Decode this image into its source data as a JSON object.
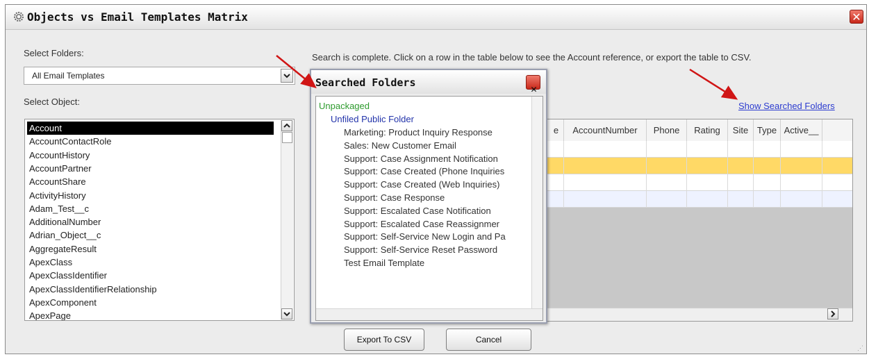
{
  "window": {
    "title": "Objects vs Email Templates Matrix"
  },
  "labels": {
    "select_folders": "Select Folders:",
    "select_object": "Select Object:"
  },
  "folder_select": {
    "value": "All Email Templates"
  },
  "objects": {
    "selected": "Account",
    "items": [
      "Account",
      "AccountContactRole",
      "AccountHistory",
      "AccountPartner",
      "AccountShare",
      "ActivityHistory",
      "Adam_Test__c",
      "AdditionalNumber",
      "Adrian_Object__c",
      "AggregateResult",
      "ApexClass",
      "ApexClassIdentifier",
      "ApexClassIdentifierRelationship",
      "ApexComponent",
      "ApexPage"
    ]
  },
  "status_message": "Search is complete. Click on a row in the table below to see the Account reference, or export the table to CSV.",
  "show_folders_link": "Show Searched Folders",
  "table": {
    "columns": [
      "e",
      "AccountNumber",
      "Phone",
      "Rating",
      "Site",
      "Type",
      "Active__"
    ],
    "highlight_row": 1
  },
  "buttons": {
    "export": "Export To CSV",
    "cancel": "Cancel"
  },
  "popup": {
    "title": "Searched Folders",
    "root": "Unpackaged",
    "folder": "Unfiled Public Folder",
    "templates": [
      "Marketing: Product Inquiry Response",
      "Sales: New Customer Email",
      "Support: Case Assignment Notification",
      "Support: Case Created (Phone Inquiries",
      "Support: Case Created (Web Inquiries)",
      "Support: Case Response",
      "Support: Escalated Case Notification",
      "Support: Escalated Case Reassignmer",
      "Support: Self-Service New Login and Pa",
      "Support: Self-Service Reset Password",
      "Test Email Template"
    ]
  },
  "colors": {
    "highlight_row": "#ffd966",
    "link": "#2b3bcf",
    "tree_root": "#2e9b2e",
    "tree_folder": "#2233aa",
    "annotation_arrow": "#d01515"
  }
}
